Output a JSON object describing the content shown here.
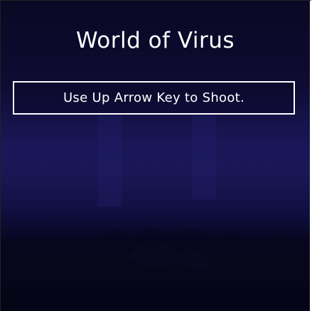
{
  "game": {
    "title": "World of Virus",
    "instruction": "Use Up Arrow Key to Shoot.",
    "colors": {
      "sky_top": "#0a0823",
      "sky_mid": "#1a1658",
      "ground": "#03030e",
      "text": "#ffffff"
    }
  }
}
